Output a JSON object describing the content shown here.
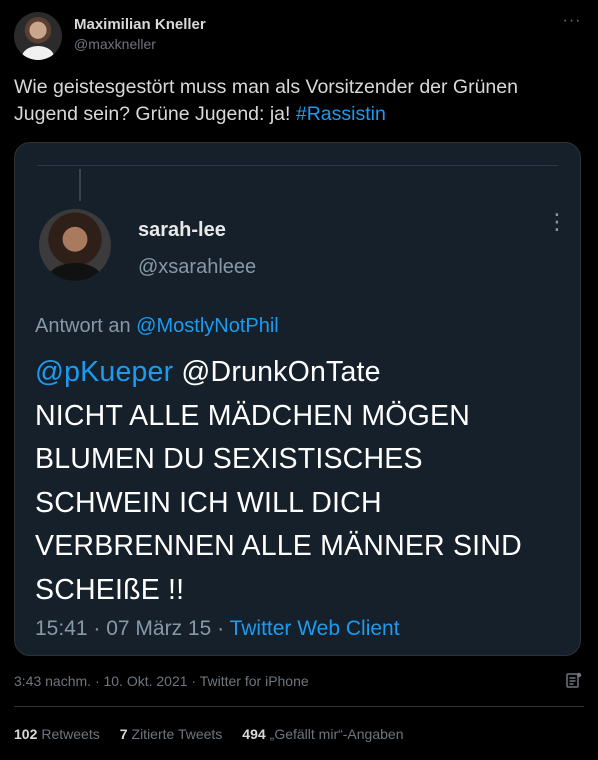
{
  "author": {
    "display_name": "Maximilian Kneller",
    "handle": "@maxkneller",
    "more_label": "···"
  },
  "tweet": {
    "text_before": "Wie geistesgestört muss man als Vorsitzender der Grünen Jugend sein? Grüne Jugend: ja! ",
    "hashtag": "#Rassistin"
  },
  "embedded": {
    "name": "sarah-lee",
    "handle": "@xsarahleee",
    "more_label": "⋮",
    "reply_prefix": "Antwort an ",
    "reply_to": "@MostlyNotPhil",
    "mention_1": "@pKueper",
    "mention_2": " @DrunkOnTate",
    "body": "NICHT ALLE MÄDCHEN MÖGEN BLUMEN DU SEXISTISCHES SCHWEIN ICH WILL DICH VERBRENNEN ALLE MÄNNER SIND SCHEIßE !!",
    "meta_time": "15:41 · 07 März 15 · ",
    "meta_client": "Twitter Web Client"
  },
  "meta": {
    "timestamp": "3:43 nachm. · 10. Okt. 2021 · Twitter for iPhone"
  },
  "stats": {
    "retweets_count": "102",
    "retweets_label": "Retweets",
    "quotes_count": "7",
    "quotes_label": "Zitierte Tweets",
    "likes_count": "494",
    "likes_label": "„Gefällt mir“-Angaben"
  },
  "colors": {
    "background": "#000000",
    "accent": "#1d9bf0",
    "embedded_background": "#15202b"
  },
  "icons": {
    "more": "more-horizontal-icon",
    "alt_text": "alt-text-icon"
  }
}
